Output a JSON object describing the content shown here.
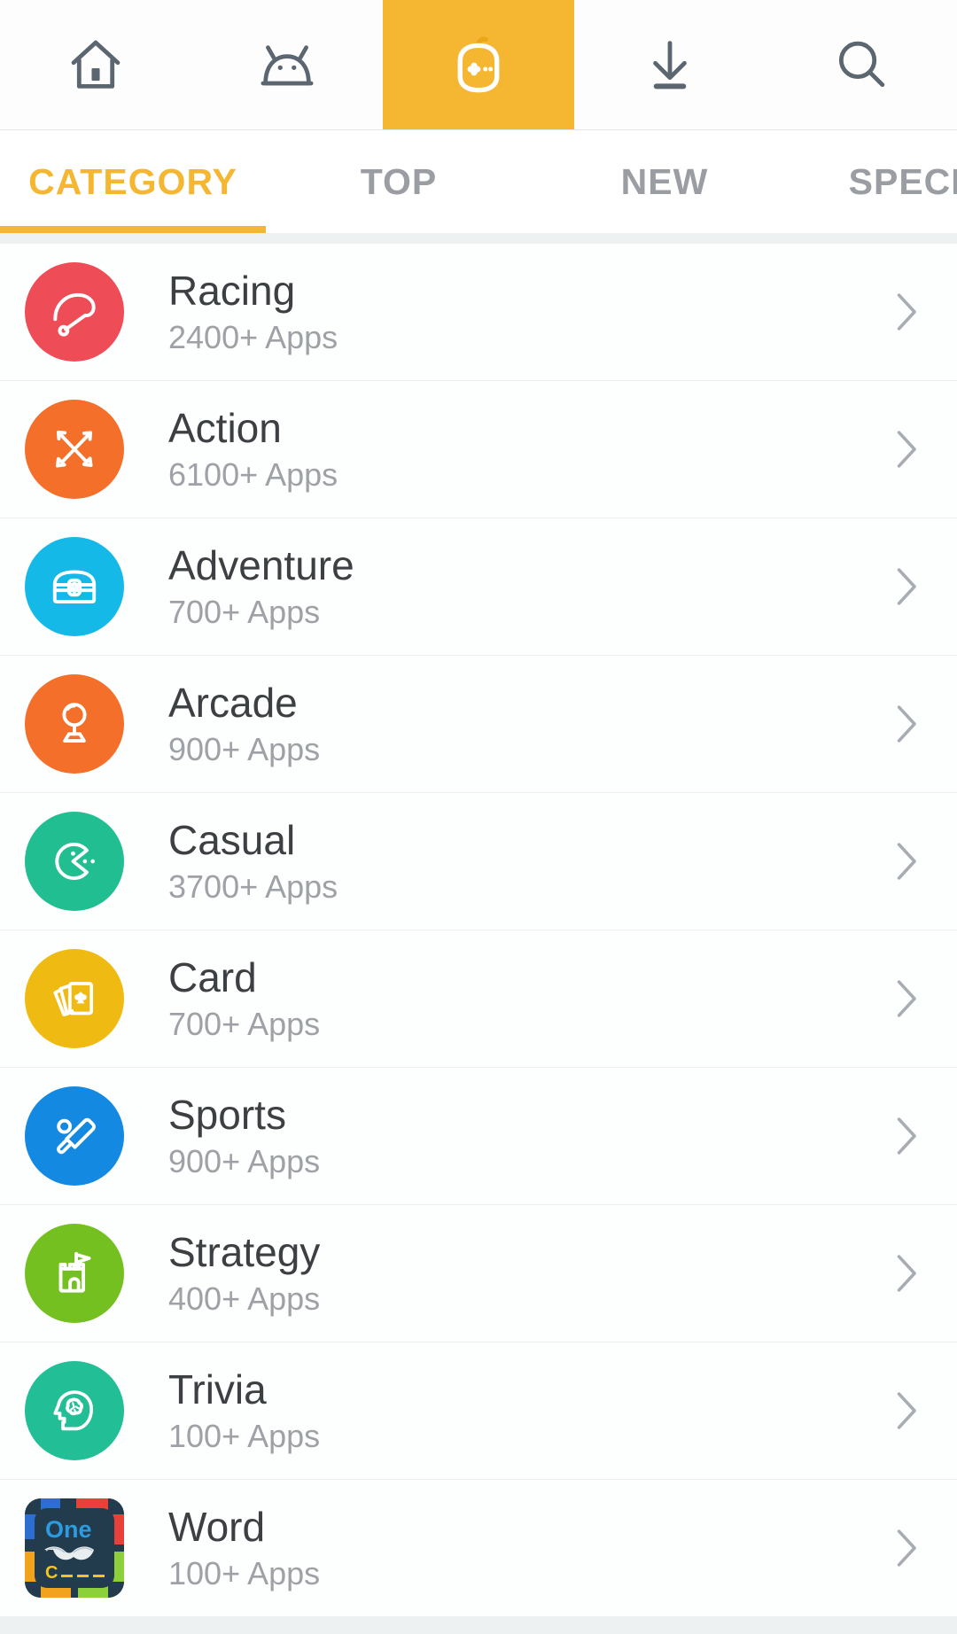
{
  "topbar": {
    "items": [
      {
        "name": "home",
        "icon": "home-icon",
        "active": false
      },
      {
        "name": "apps",
        "icon": "android-robot-icon",
        "active": false
      },
      {
        "name": "games",
        "icon": "game-controller-icon",
        "active": true
      },
      {
        "name": "downloads",
        "icon": "download-icon",
        "active": false
      },
      {
        "name": "search",
        "icon": "search-icon",
        "active": false
      }
    ],
    "accent_color": "#F5B731"
  },
  "tabs": {
    "items": [
      {
        "label": "CATEGORY",
        "active": true
      },
      {
        "label": "TOP",
        "active": false
      },
      {
        "label": "NEW",
        "active": false
      },
      {
        "label": "SPECIAL",
        "active": false
      }
    ],
    "active_color": "#F5B731",
    "inactive_color": "#9a9ea3"
  },
  "categories": [
    {
      "title": "Racing",
      "count": "2400+ Apps",
      "icon": "speedometer-icon",
      "color": "#EE4C56",
      "shape": "circle"
    },
    {
      "title": "Action",
      "count": "6100+ Apps",
      "icon": "crossed-swords-icon",
      "color": "#F4702A",
      "shape": "circle"
    },
    {
      "title": "Adventure",
      "count": "700+ Apps",
      "icon": "treasure-chest-icon",
      "color": "#15B9E8",
      "shape": "circle"
    },
    {
      "title": "Arcade",
      "count": "900+ Apps",
      "icon": "joystick-icon",
      "color": "#F4702A",
      "shape": "circle"
    },
    {
      "title": "Casual",
      "count": "3700+ Apps",
      "icon": "pacman-icon",
      "color": "#21BE92",
      "shape": "circle"
    },
    {
      "title": "Card",
      "count": "700+ Apps",
      "icon": "playing-cards-icon",
      "color": "#EFBB13",
      "shape": "circle"
    },
    {
      "title": "Sports",
      "count": "900+ Apps",
      "icon": "cricket-bat-icon",
      "color": "#1489E2",
      "shape": "circle"
    },
    {
      "title": "Strategy",
      "count": "400+ Apps",
      "icon": "castle-flag-icon",
      "color": "#74C020",
      "shape": "circle"
    },
    {
      "title": "Trivia",
      "count": "100+ Apps",
      "icon": "brain-head-icon",
      "color": "#22BE95",
      "shape": "circle"
    },
    {
      "title": "Word",
      "count": "100+ Apps",
      "icon": "one-mustache-app-icon",
      "color": "#223B4D",
      "shape": "square"
    }
  ],
  "chevron": "chevron-right-icon"
}
